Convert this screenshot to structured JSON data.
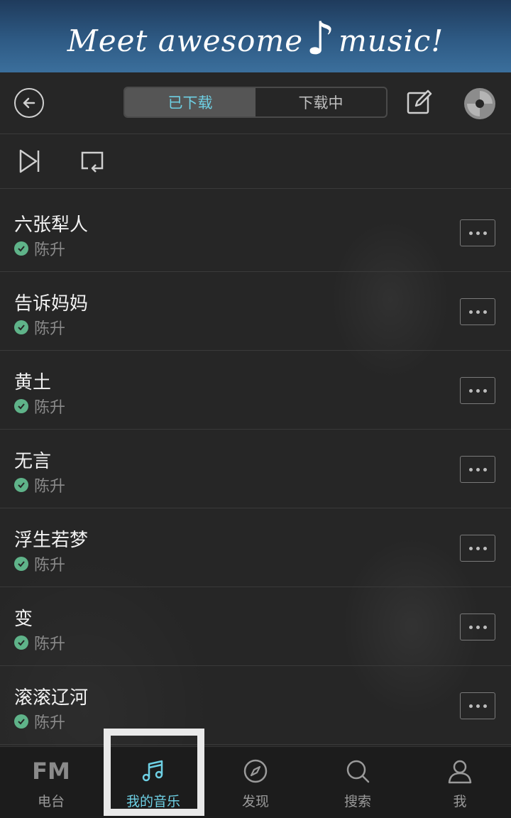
{
  "banner": {
    "text_before": "Meet awesome",
    "text_after": "music!"
  },
  "toolbar": {
    "tabs": [
      {
        "label": "已下载",
        "active": true
      },
      {
        "label": "下载中",
        "active": false
      }
    ]
  },
  "songs": [
    {
      "title": "六张犁人",
      "artist": "陈升"
    },
    {
      "title": "告诉妈妈",
      "artist": "陈升"
    },
    {
      "title": "黄土",
      "artist": "陈升"
    },
    {
      "title": "无言",
      "artist": "陈升"
    },
    {
      "title": "浮生若梦",
      "artist": "陈升"
    },
    {
      "title": "变",
      "artist": "陈升"
    },
    {
      "title": "滚滚辽河",
      "artist": "陈升"
    }
  ],
  "nav": {
    "fm_icon_text": "FM",
    "items": [
      {
        "label": "电台",
        "icon": "fm-icon"
      },
      {
        "label": "我的音乐",
        "icon": "music-note-icon",
        "active": true
      },
      {
        "label": "发现",
        "icon": "compass-icon"
      },
      {
        "label": "搜索",
        "icon": "search-icon"
      },
      {
        "label": "我",
        "icon": "user-icon"
      }
    ]
  },
  "colors": {
    "accent": "#6ed0e4",
    "check": "#5fb389",
    "banner": "#2e5a84"
  }
}
